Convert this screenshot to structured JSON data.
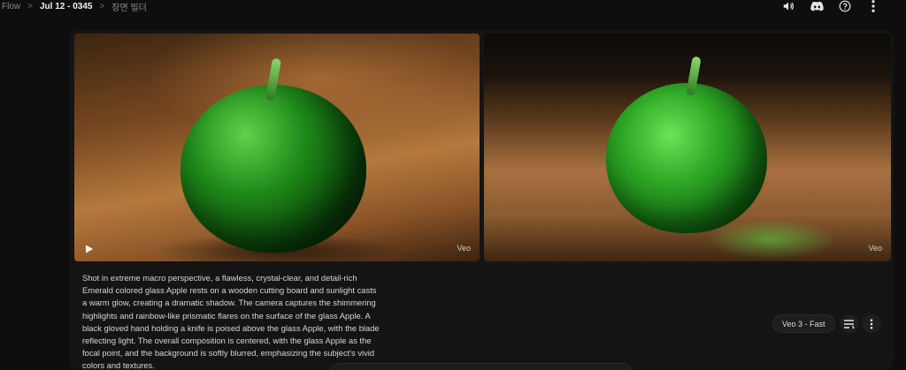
{
  "breadcrumb": {
    "root": "Flow",
    "project": "Jul 12 - 0345",
    "scene": "장면 빌더",
    "separator": ">"
  },
  "top_icons": [
    "volume-icon",
    "discord-icon",
    "help-icon",
    "more-vertical-icon"
  ],
  "videos": [
    {
      "watermark": "Veo",
      "play_icon": "play-icon"
    },
    {
      "watermark": "Veo"
    }
  ],
  "prompt_text": "Shot in extreme macro perspective, a flawless, crystal-clear, and detail-rich Emerald colored glass Apple rests on a wooden cutting board and sunlight casts a warm glow, creating a dramatic shadow. The camera captures the shimmering highlights and rainbow-like prismatic flares on the surface of the glass Apple. A black gloved hand holding a knife is poised above the glass Apple, with the blade reflecting light. The overall composition is centered, with the glass Apple as the focal point, and the background is softly blurred, emphasizing the subject's vivid colors and textures.",
  "model_chip": "Veo 3 - Fast",
  "actions": {
    "reuse_icon": "reuse-prompt-icon",
    "more_icon": "more-vertical-icon"
  },
  "colors": {
    "background": "#0e0e0e",
    "card": "#141414",
    "chip": "#1e1e1e"
  }
}
